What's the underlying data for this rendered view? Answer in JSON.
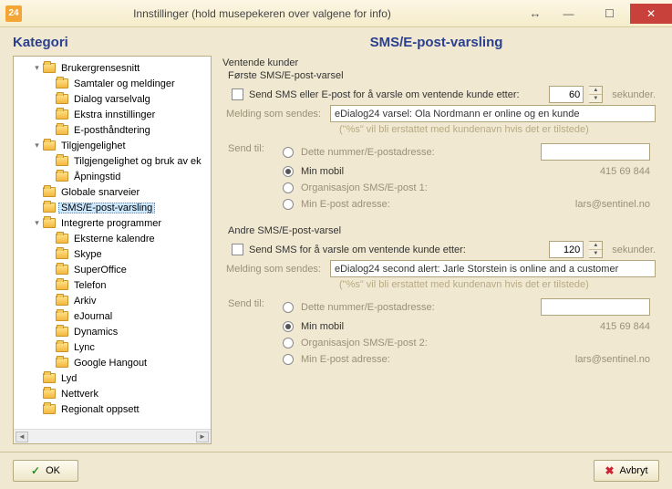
{
  "window": {
    "title": "Innstillinger (hold musepekeren over valgene for info)"
  },
  "headings": {
    "category": "Kategori",
    "panel": "SMS/E-post-varsling"
  },
  "tree": {
    "items": [
      {
        "label": "Brukergrensesnitt",
        "level": 1,
        "expander": "▾",
        "sel": false
      },
      {
        "label": "Samtaler og meldinger",
        "level": 2,
        "expander": "",
        "sel": false
      },
      {
        "label": "Dialog varselvalg",
        "level": 2,
        "expander": "",
        "sel": false
      },
      {
        "label": "Ekstra innstillinger",
        "level": 2,
        "expander": "",
        "sel": false
      },
      {
        "label": "E-posthåndtering",
        "level": 2,
        "expander": "",
        "sel": false
      },
      {
        "label": "Tilgjengelighet",
        "level": 1,
        "expander": "▾",
        "sel": false
      },
      {
        "label": "Tilgjengelighet og bruk av ek",
        "level": 2,
        "expander": "",
        "sel": false
      },
      {
        "label": "Åpningstid",
        "level": 2,
        "expander": "",
        "sel": false
      },
      {
        "label": "Globale snarveier",
        "level": 1,
        "expander": "",
        "sel": false
      },
      {
        "label": "SMS/E-post-varsling",
        "level": 1,
        "expander": "",
        "sel": true
      },
      {
        "label": "Integrerte programmer",
        "level": 1,
        "expander": "▾",
        "sel": false
      },
      {
        "label": "Eksterne kalendre",
        "level": 2,
        "expander": "",
        "sel": false
      },
      {
        "label": "Skype",
        "level": 2,
        "expander": "",
        "sel": false
      },
      {
        "label": "SuperOffice",
        "level": 2,
        "expander": "",
        "sel": false
      },
      {
        "label": "Telefon",
        "level": 2,
        "expander": "",
        "sel": false
      },
      {
        "label": "Arkiv",
        "level": 2,
        "expander": "",
        "sel": false
      },
      {
        "label": "eJournal",
        "level": 2,
        "expander": "",
        "sel": false
      },
      {
        "label": "Dynamics",
        "level": 2,
        "expander": "",
        "sel": false
      },
      {
        "label": "Lync",
        "level": 2,
        "expander": "",
        "sel": false
      },
      {
        "label": "Google Hangout",
        "level": 2,
        "expander": "",
        "sel": false
      },
      {
        "label": "Lyd",
        "level": 1,
        "expander": "",
        "sel": false
      },
      {
        "label": "Nettverk",
        "level": 1,
        "expander": "",
        "sel": false
      },
      {
        "label": "Regionalt oppsett",
        "level": 1,
        "expander": "",
        "sel": false
      }
    ]
  },
  "panel": {
    "pending_header": "Ventende kunder",
    "first": {
      "title": "Første SMS/E-post-varsel",
      "checkbox_label": "Send SMS eller E-post for å varsle om ventende kunde etter:",
      "seconds_value": "60",
      "seconds_unit": "sekunder.",
      "msg_label": "Melding som sendes:",
      "msg_value": "eDialog24 varsel: Ola Nordmann er online og en kunde",
      "hint": "(\"%s\" vil bli erstattet med kundenavn hvis det er tilstede)",
      "sendto_label": "Send til:",
      "radios": {
        "r1": "Dette nummer/E-postadresse:",
        "r2": "Min mobil",
        "r2_val": "415 69 844",
        "r3": "Organisasjon SMS/E-post 1:",
        "r4": "Min E-post adresse:",
        "r4_val": "lars@sentinel.no"
      }
    },
    "second": {
      "title": "Andre SMS/E-post-varsel",
      "checkbox_label": "Send SMS for å varsle om ventende kunde etter:",
      "seconds_value": "120",
      "seconds_unit": "sekunder.",
      "msg_label": "Melding som sendes:",
      "msg_value": "eDialog24 second alert: Jarle Storstein is online and a customer ",
      "hint": "(\"%s\" vil bli erstattet med kundenavn hvis det er tilstede)",
      "sendto_label": "Send til:",
      "radios": {
        "r1": "Dette nummer/E-postadresse:",
        "r2": "Min mobil",
        "r2_val": "415 69 844",
        "r3": "Organisasjon SMS/E-post 2:",
        "r4": "Min E-post adresse:",
        "r4_val": "lars@sentinel.no"
      }
    }
  },
  "footer": {
    "ok": "OK",
    "cancel": "Avbryt"
  }
}
